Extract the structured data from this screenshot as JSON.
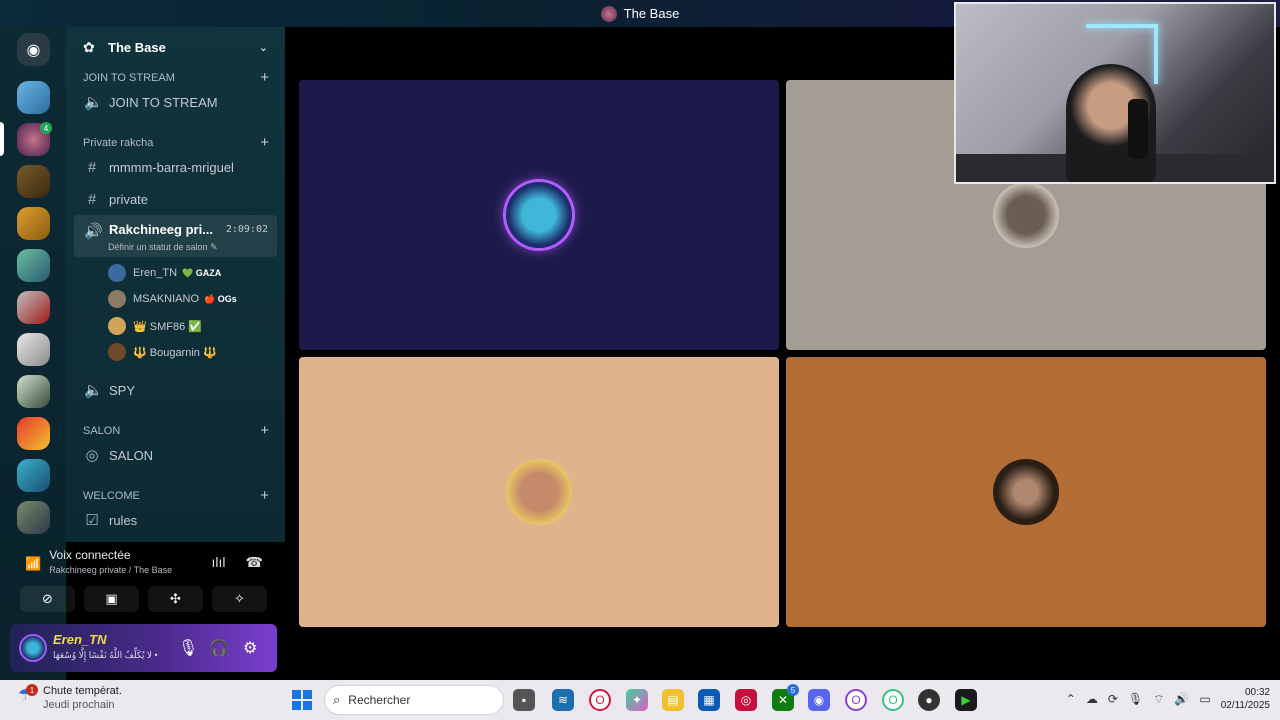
{
  "window": {
    "title": "The Base"
  },
  "guild": {
    "name": "The Base"
  },
  "categories": {
    "join": "JOIN TO STREAM",
    "private": "Private rakcha",
    "salon": "SALON",
    "welcome": "WELCOME"
  },
  "channels": {
    "join_to_stream": "JOIN TO STREAM",
    "mmmm": "mmmm-barra-mriguel",
    "private": "private",
    "rakchineeg": "Rakchineeg pri...",
    "rakchineeg_timer": "2:09:02",
    "rakchineeg_status": "Définir un statut de salon",
    "spy": "SPY",
    "salon": "SALON",
    "rules": "rules"
  },
  "voice_users": [
    {
      "name": "Eren_TN",
      "tag": "💚 GAZA",
      "avatar_color": "#3b6aa0"
    },
    {
      "name": "MSAKNIANO",
      "tag": "🍎 OGs",
      "avatar_color": "#8a7a66"
    },
    {
      "name": "👑 SMF86 ✅",
      "tag": "",
      "avatar_color": "#d4a35a"
    },
    {
      "name": "🔱 Bougarnin 🔱",
      "tag": "",
      "avatar_color": "#6b4a2a"
    }
  ],
  "voice_panel": {
    "title": "Voix connectée",
    "subtitle": "Rakchineeg private / The Base"
  },
  "user_panel": {
    "name": "Eren_TN",
    "status": "لا يُكَلِّفُ اللَّهُ نَفْسًا إِلَّا وُسْعَهَا •"
  },
  "tiles": [
    {
      "bg": "#1b1a4a",
      "avatar": "#3fb7d9"
    },
    {
      "bg": "#a39d93",
      "avatar": "#6a5d52"
    },
    {
      "bg": "#dfb48d",
      "avatar": "#e0a850"
    },
    {
      "bg": "#b36c34",
      "avatar": "#3a2a1c"
    }
  ],
  "taskbar": {
    "weather_title": "Chute températ.",
    "weather_sub": "Jeudi prochain",
    "weather_badge": "1",
    "search_placeholder": "Rechercher",
    "time": "00:32",
    "date": "02/11/2025",
    "xbox_badge": "5"
  }
}
